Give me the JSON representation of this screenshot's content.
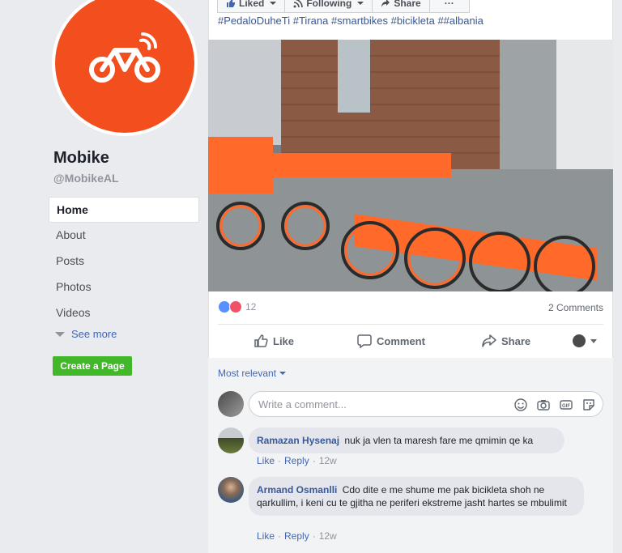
{
  "page": {
    "name": "Mobike",
    "handle": "@MobikeAL",
    "nav": [
      "Home",
      "About",
      "Posts",
      "Photos",
      "Videos"
    ],
    "see_more": "See more",
    "create_page": "Create a Page"
  },
  "post": {
    "top_buttons": {
      "liked": "Liked",
      "following": "Following",
      "share": "Share",
      "more": "···"
    },
    "hashtags": "#PedaloDuheTi #Tirana #smartbikes #biçikleta ##albania",
    "reaction_count": "12",
    "comments_count": "2 Comments",
    "actions": {
      "like": "Like",
      "comment": "Comment",
      "share": "Share"
    },
    "sort_label": "Most relevant",
    "write_placeholder": "Write a comment...",
    "comments": [
      {
        "author": "Ramazan Hysenaj",
        "text": "nuk ja vlen ta maresh fare me qmimin qe ka",
        "like": "Like",
        "reply": "Reply",
        "time": "12w"
      },
      {
        "author": "Armand Osmanlli",
        "text": "Cdo dite e me shume me pak bicikleta shoh ne qarkullim, i keni cu te gjitha ne periferi ekstreme jasht hartes se mbulimit",
        "like": "Like",
        "reply": "Reply",
        "time": "12w"
      }
    ]
  },
  "colors": {
    "brand": "#f24e1e",
    "fb_blue": "#4267b2",
    "green": "#42b72a"
  }
}
